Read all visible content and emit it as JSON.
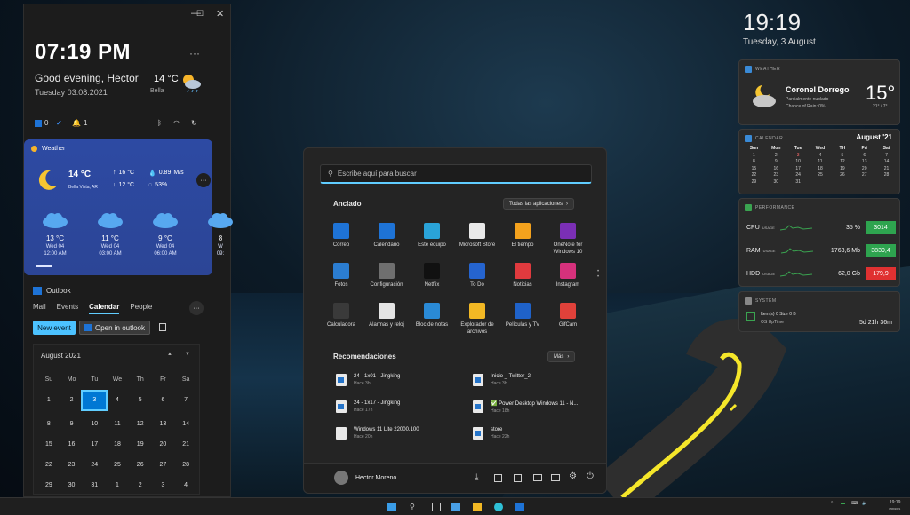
{
  "colors": {
    "accent": "#60cdff",
    "selection": "#0078d4",
    "weather_card": "#2d4aa3",
    "cpu_badge": "#2ea44f",
    "ram_badge": "#2ea44f",
    "hdd_badge": "#e03131"
  },
  "left_panel": {
    "window_controls": [
      "—",
      "☐",
      "✕"
    ],
    "time": "07:19 PM",
    "more": "···",
    "greeting": "Good evening, Hector",
    "date": "Tuesday 03.08.2021",
    "temp": "14 °C",
    "location": "Bella",
    "status": {
      "mail_count": "0",
      "todo_label": "✔",
      "alerts_count": "1"
    },
    "weather": {
      "title": "Weather",
      "temp": "14 °C",
      "location": "Bella Vista, AR",
      "high": "16 °C",
      "low": "12 °C",
      "rain": "0.89",
      "rain_unit": "M/s",
      "humidity": "53%",
      "forecast": [
        {
          "temp": "13 °C",
          "day": "Wed 04",
          "time": "12:00 AM"
        },
        {
          "temp": "11 °C",
          "day": "Wed 04",
          "time": "03:00 AM"
        },
        {
          "temp": "9 °C",
          "day": "Wed 04",
          "time": "06:00 AM"
        },
        {
          "temp": "8",
          "day": "W",
          "time": "09:"
        }
      ]
    },
    "outlook": {
      "title": "Outlook",
      "tabs": [
        "Mail",
        "Events",
        "Calendar",
        "People"
      ],
      "new_event": "New event",
      "open_in_outlook": "Open in outlook",
      "month": "August 2021",
      "weekdays": [
        "Su",
        "Mo",
        "Tu",
        "We",
        "Th",
        "Fr",
        "Sa"
      ],
      "days": [
        "1",
        "2",
        "3",
        "4",
        "5",
        "6",
        "7",
        "8",
        "9",
        "10",
        "11",
        "12",
        "13",
        "14",
        "15",
        "16",
        "17",
        "18",
        "19",
        "20",
        "21",
        "22",
        "23",
        "24",
        "25",
        "26",
        "27",
        "28",
        "29",
        "30",
        "31",
        "1",
        "2",
        "3",
        "4"
      ]
    }
  },
  "start_menu": {
    "search_placeholder": "Escribe aquí para buscar",
    "pinned_title": "Anclado",
    "all_apps": "Todas las aplicaciones",
    "pinned": [
      {
        "label": "Correo",
        "icon": "mail-icon",
        "color": "#1e73d6"
      },
      {
        "label": "Calendario",
        "icon": "calendar-icon",
        "color": "#1e73d6"
      },
      {
        "label": "Este equipo",
        "icon": "computer-icon",
        "color": "#2aa3d8"
      },
      {
        "label": "Microsoft Store",
        "icon": "store-icon",
        "color": "#e9e9e9"
      },
      {
        "label": "El tiempo",
        "icon": "weather-icon",
        "color": "#f4a21d"
      },
      {
        "label": "OneNote for Windows 10",
        "icon": "onenote-icon",
        "color": "#7b2fb5"
      },
      {
        "label": "Fotos",
        "icon": "photos-icon",
        "color": "#2b7dd1"
      },
      {
        "label": "Configuración",
        "icon": "settings-icon",
        "color": "#6f6f6f"
      },
      {
        "label": "Netflix",
        "icon": "netflix-icon",
        "color": "#111111"
      },
      {
        "label": "To Do",
        "icon": "todo-icon",
        "color": "#2564cf"
      },
      {
        "label": "Noticias",
        "icon": "news-icon",
        "color": "#e03a3e"
      },
      {
        "label": "Instagram",
        "icon": "instagram-icon",
        "color": "#d6317c"
      },
      {
        "label": "Calculadora",
        "icon": "calculator-icon",
        "color": "#3a3a3a"
      },
      {
        "label": "Alarmas y reloj",
        "icon": "clock-icon",
        "color": "#e4e4e4"
      },
      {
        "label": "Bloc de notas",
        "icon": "notepad-icon",
        "color": "#2a8ad6"
      },
      {
        "label": "Explorador de archivos",
        "icon": "folder-icon",
        "color": "#f2b824"
      },
      {
        "label": "Películas y TV",
        "icon": "movies-icon",
        "color": "#1f62c9"
      },
      {
        "label": "GifCam",
        "icon": "gifcam-icon",
        "color": "#e0413a"
      }
    ],
    "recommended_title": "Recomendaciones",
    "more": "Más",
    "recommended": [
      {
        "title": "24 - 1x01 - Jingking",
        "sub": "Hace 3h"
      },
      {
        "title": "Inicio _ Twitter_2",
        "sub": "Hace 3h"
      },
      {
        "title": "24 - 1x17 - Jingking",
        "sub": "Hace 17h"
      },
      {
        "title": "✅ Power Desktop Windows 11 - N...",
        "sub": "Hace 18h"
      },
      {
        "title": "Windows 11 Lite 22000.100",
        "sub": "Hace 20h"
      },
      {
        "title": "store",
        "sub": "Hace 22h"
      }
    ],
    "user": "Hector Moreno"
  },
  "right": {
    "time": "19:19",
    "date": "Tuesday, 3 August",
    "weather": {
      "header": "WEATHER",
      "city": "Coronel Dorrego",
      "desc": "Parcialmente nublado",
      "rain": "Chance of Rain: 0%",
      "temp": "15°",
      "range": "21° / 7°"
    },
    "calendar": {
      "header": "CALENDAR",
      "month": "August '21",
      "weekdays": [
        "Sun",
        "Mon",
        "Tue",
        "Wed",
        "TH",
        "Fri",
        "Sat"
      ],
      "days": [
        "1",
        "2",
        "3",
        "4",
        "5",
        "6",
        "7",
        "8",
        "9",
        "10",
        "11",
        "12",
        "13",
        "14",
        "15",
        "16",
        "17",
        "18",
        "19",
        "20",
        "21",
        "22",
        "23",
        "24",
        "25",
        "26",
        "27",
        "28",
        "29",
        "30",
        "31"
      ]
    },
    "performance": {
      "header": "PERFORMANCE",
      "rows": [
        {
          "name": "CPU",
          "usage": "USAGE",
          "value": "35 %",
          "badge": "3014"
        },
        {
          "name": "RAM",
          "usage": "USAGE",
          "value": "1763,6 Mb",
          "badge": "3839,4"
        },
        {
          "name": "HDD",
          "usage": "USAGE",
          "value": "62,0 Gb",
          "badge": "179,9"
        }
      ]
    },
    "system": {
      "header": "SYSTEM",
      "items": "Item(s) 0 Size 0 B",
      "uptime_label": "OS UpTime",
      "uptime": "5d 21h 36m"
    }
  },
  "taskbar": {
    "time": "19:19",
    "date": "3/08/2021"
  }
}
